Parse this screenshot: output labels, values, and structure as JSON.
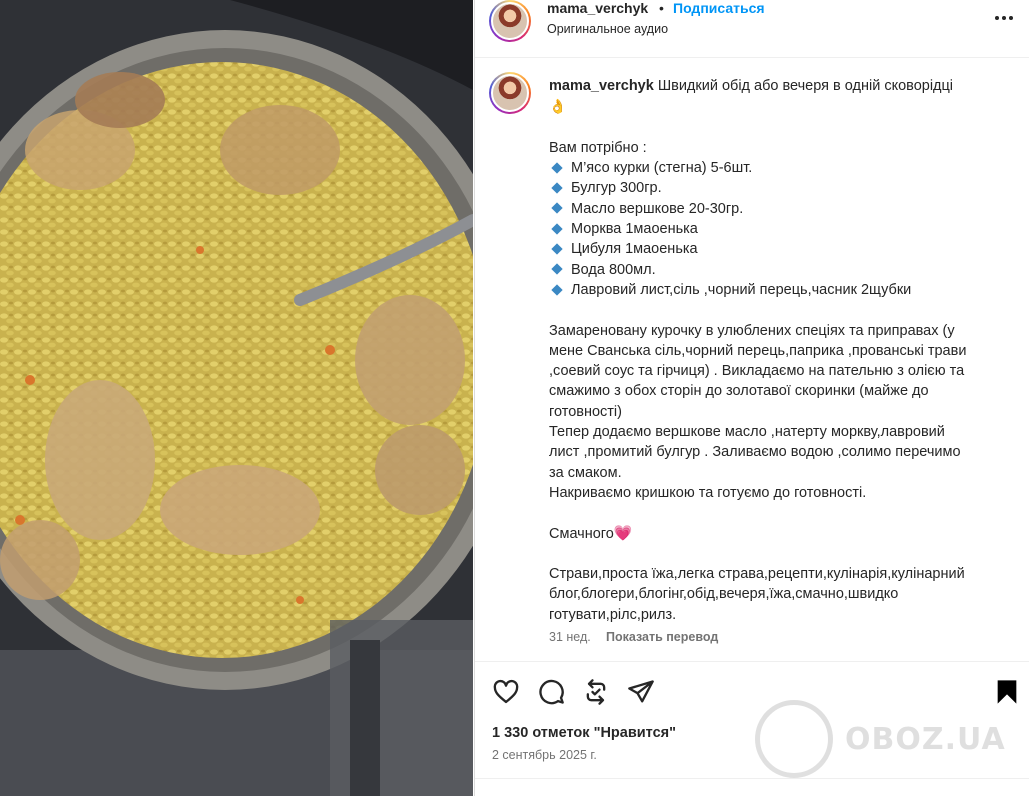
{
  "header": {
    "username": "mama_verchyk",
    "separator": "•",
    "follow_label": "Подписаться",
    "audio": "Оригинальное аудио",
    "more_icon": "more-horizontal-icon"
  },
  "caption": {
    "username": "mama_verchyk",
    "title": "Швидкий обід або вечеря в одній сковорідці",
    "title_emoji": "👌",
    "intro": "Вам потрібно :",
    "ingredients": [
      "М’ясо курки (стегна) 5-6шт.",
      "Булгур 300гр.",
      "Масло вершкове 20-30гр.",
      "Морква 1маоенька",
      "Цибуля 1маоенька",
      "Вода 800мл.",
      "Лавровий лист,сіль ,чорний перець,часник 2щубки"
    ],
    "steps": [
      "Замареновану курочку в улюблених спеціях та приправах (у",
      "мене Сванська сіль,чорний перець,паприка ,прованські трави",
      ",соевий соус та гірчиця) . Викладаємо на пательню з олією та",
      "смажимо з обох сторін до золотавої скоринки (майже до",
      "готовності)",
      "Тепер додаємо вершкове масло ,натерту моркву,лавровий",
      "лист ,промитий булгур . Заливаємо водою ,солимо перечимо",
      "за смаком.",
      "Накриваємо кришкою та готуємо до готовності."
    ],
    "closing": "Смачного",
    "closing_emoji": "💗",
    "tags": [
      "Страви,проста їжа,легка страва,рецепти,кулінарія,кулінарний",
      "блог,блогери,блогінг,обід,вечеря,їжа,смачно,швидко",
      "готувати,рілс,рилз."
    ],
    "age": "31 нед.",
    "translate_label": "Показать перевод"
  },
  "actions": {
    "like_icon": "heart-icon",
    "comment_icon": "comment-icon",
    "repost_icon": "repost-icon",
    "share_icon": "send-icon",
    "save_icon": "bookmark-icon",
    "likes_text": "1 330 отметок \"Нравится\"",
    "date": "2 сентябрь 2025 г."
  },
  "watermark": {
    "text": "OBOZ.UA"
  },
  "colors": {
    "accent_blue": "#0095f6",
    "text_primary": "#262626",
    "text_secondary": "#737373",
    "bullet_blue": "#3b88c3"
  }
}
